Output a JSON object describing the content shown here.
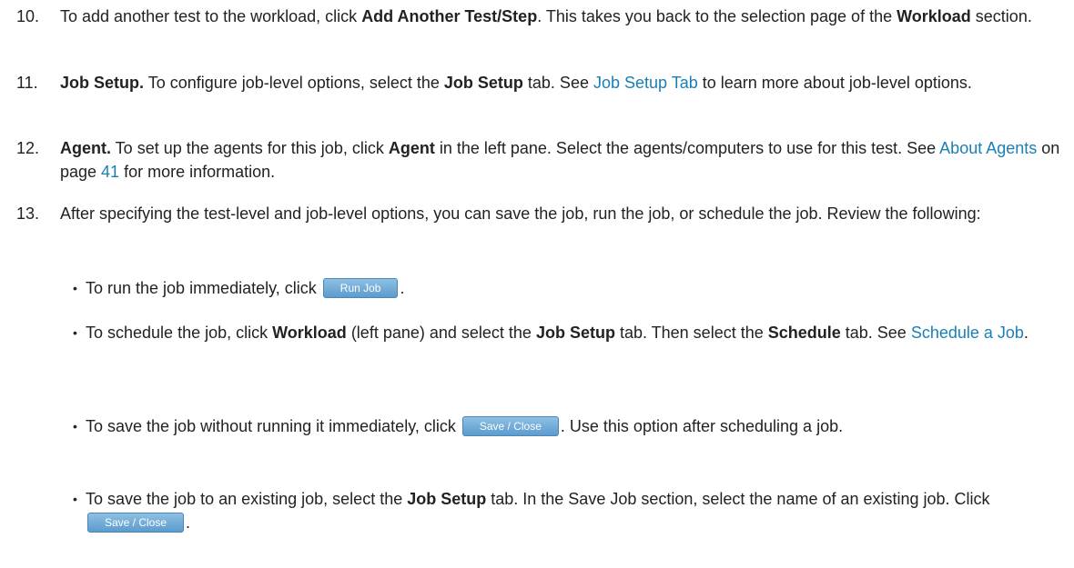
{
  "steps": [
    {
      "num": "10.",
      "t1": "To add another test to the workload, click ",
      "b1": "Add Another Test/Step",
      "t2": ". This takes you back to the selection page of the ",
      "b2": "Workload",
      "t3": " section."
    },
    {
      "num": "11.",
      "b1": "Job Setup.",
      "t1": " To configure job-level options, select the ",
      "b2": "Job Setup",
      "t2": " tab. See ",
      "link": "Job Setup Tab",
      "t3": " to learn more about job-level options."
    },
    {
      "num": "12.",
      "b1": "Agent.",
      "t1": " To set up the agents for this job, click ",
      "b2": "Agent",
      "t2": " in the left pane. Select the agents/computers to use for this test. See ",
      "link": "About Agents",
      "t3": " on page ",
      "link2": "41",
      "t4": " for more information."
    },
    {
      "num": "13.",
      "t1": "After specifying the test-level and job-level options, you can save the job, run the job, or schedule the job. Review the following:"
    }
  ],
  "bullets": [
    {
      "t1": "To run the job immediately, click ",
      "button": "Run Job",
      "t2": "."
    },
    {
      "t1": "To schedule the job, click ",
      "b1": "Workload",
      "t2": " (left pane) and select the ",
      "b2": "Job Setup",
      "t3": " tab. Then select the ",
      "b3": "Schedule",
      "t4": " tab. See ",
      "link": "Schedule a Job",
      "t5": "."
    },
    {
      "t1": "To save the job without running it immediately, click ",
      "button": "Save / Close",
      "t2": ". Use this option after scheduling a job."
    },
    {
      "t1": "To save the job to an existing job, select the ",
      "b1": "Job Setup",
      "t2": " tab. In the Save Job section, select the name of an existing job. Click ",
      "button": "Save / Close",
      "t3": "."
    }
  ],
  "bullet_glyph": "•"
}
